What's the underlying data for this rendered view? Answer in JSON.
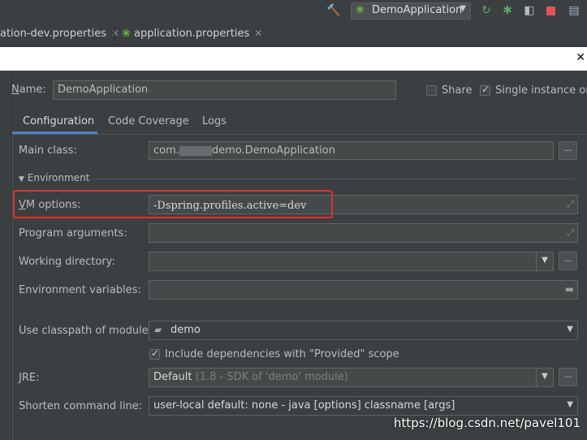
{
  "toolbar": {
    "run_config": "DemoApplication",
    "icons": [
      "hammer-icon",
      "spring-icon",
      "rerun-icon",
      "debug-icon",
      "coverage-icon",
      "stop-icon",
      "folder-icon"
    ],
    "colors": {
      "green": "#59a869",
      "red": "#e05555"
    }
  },
  "tabs": [
    {
      "label": "ation-dev.properties"
    },
    {
      "label": "application.properties"
    }
  ],
  "dialog": {
    "name_label": "Name:",
    "name_value": "DemoApplication",
    "share_label": "Share",
    "single_instance_label": "Single instance only",
    "single_instance_checked": true,
    "share_checked": false,
    "subtabs": [
      "Configuration",
      "Code Coverage",
      "Logs"
    ],
    "active_subtab": "Configuration",
    "main_class_label": "Main class:",
    "main_class_value_a": "com.",
    "main_class_value_b": "demo.DemoApplication",
    "environment_label": "Environment",
    "vm_options_label": "VM options:",
    "vm_options_value": "-Dspring.profiles.active=dev",
    "program_args_label": "Program arguments:",
    "working_dir_label": "Working directory:",
    "env_vars_label": "Environment variables:",
    "classpath_label": "Use classpath of module:",
    "classpath_value": "demo",
    "include_deps_label": "Include dependencies with \"Provided\" scope",
    "include_deps_checked": true,
    "jre_label": "JRE:",
    "jre_value": "Default",
    "jre_hint": "(1.8 - SDK of 'demo' module)",
    "shorten_label": "Shorten command line:",
    "shorten_value": "user-local default: none - java [options] classname [args]",
    "ellipsis": "..."
  },
  "watermark": "https://blog.csdn.net/pavel101"
}
